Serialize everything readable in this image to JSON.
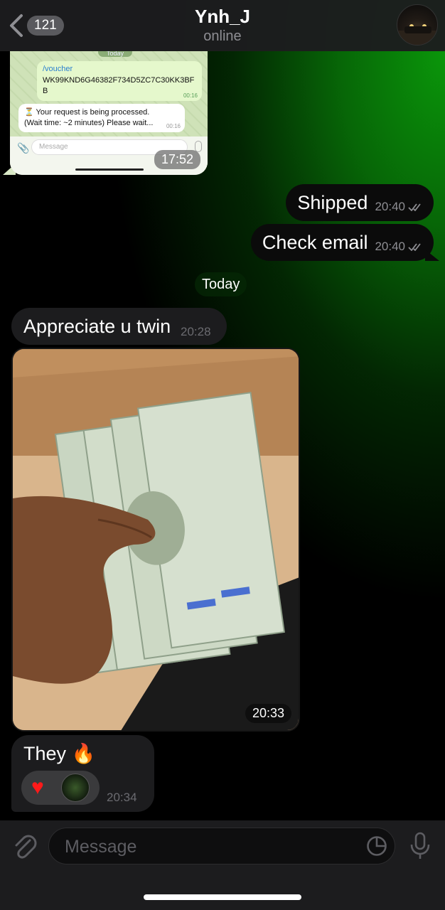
{
  "header": {
    "unread_count": "121",
    "title": "Ynh_J",
    "status": "online"
  },
  "screenshot": {
    "date_label": "Today",
    "outgoing_command": "/voucher",
    "outgoing_code": "WK99KND6G46382F734D5ZC7C30KK3BFB",
    "outgoing_time": "00:16",
    "incoming_text": "⏳ Your request is being processed. (Wait time: ~2 minutes) Please wait...",
    "incoming_time": "00:16",
    "input_placeholder": "Message",
    "time": "17:52"
  },
  "messages": {
    "out1": {
      "text": "Shipped",
      "time": "20:40"
    },
    "out2": {
      "text": "Check email",
      "time": "20:40"
    },
    "date_divider": "Today",
    "in1": {
      "text": "Appreciate u twin",
      "time": "20:28"
    },
    "photo_time": "20:33",
    "in2": {
      "text": "They 🔥",
      "time": "20:34",
      "reaction": "♥"
    }
  },
  "input": {
    "placeholder": "Message"
  },
  "colors": {
    "accent_green": "#0a960a",
    "bubble_in": "#1c1c1e",
    "bubble_out": "#0b0b0b",
    "reaction_heart": "#ff1a1a"
  }
}
